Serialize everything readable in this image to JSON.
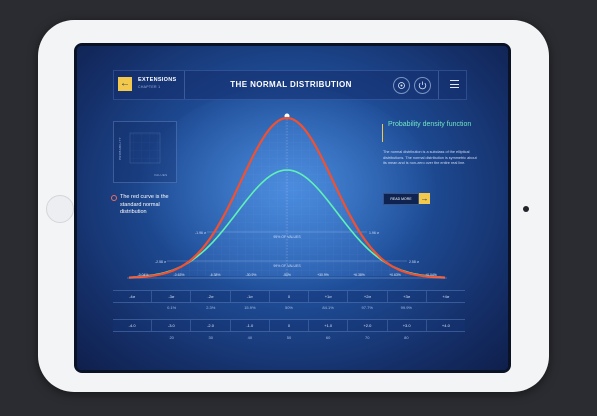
{
  "header": {
    "back_glyph": "←",
    "extensions": "EXTENSIONS",
    "chapter": "CHAPTER 1",
    "title": "THE NORMAL DISTRIBUTION"
  },
  "mini_chart": {
    "y_label": "PROBABILITY",
    "x_label": "VALUES"
  },
  "note": {
    "text": "The red curve is the standard normal distribution"
  },
  "info": {
    "title": "Probability density function",
    "description": "The normal distribution is a subclass of the elliptical distributions. The normal distribution is symmetric about its mean and is non-zero over the entire real line.",
    "read_more": "READ MORE",
    "arrow": "→"
  },
  "chart_data": {
    "type": "line",
    "series": [],
    "sigma_labels": [
      "-1.96 σ",
      "1.96 σ",
      "-2.58 σ",
      "2.58 σ"
    ],
    "band_labels": [
      "95% OF VALUES",
      "99% OF VALUES"
    ],
    "x_tick_labels": [
      "-0.04%",
      "-0.63%",
      "-6.38%",
      "-30.9%",
      "-50%",
      "+30.9%",
      "+6.38%",
      "+0.63%",
      "+0.04%"
    ],
    "grid": true
  },
  "table": {
    "row1": [
      "-4σ",
      "-3σ",
      "-2σ",
      "-1σ",
      "0",
      "+1σ",
      "+2σ",
      "+3σ",
      "+4σ"
    ],
    "row2": [
      "",
      "0.1%",
      "2.3%",
      "15.9%",
      "50%",
      "84.1%",
      "97.7%",
      "99.9%",
      ""
    ],
    "row3": [
      "-4.0",
      "-3.0",
      "-2.0",
      "-1.0",
      "0",
      "+1.0",
      "+2.0",
      "+3.0",
      "+4.0"
    ],
    "row4": [
      "",
      "20",
      "30",
      "40",
      "50",
      "60",
      "70",
      "80",
      ""
    ]
  },
  "colors": {
    "red_curve": "#f2502f",
    "green_curve": "#5ef2b4",
    "accent": "#f2c94c"
  }
}
